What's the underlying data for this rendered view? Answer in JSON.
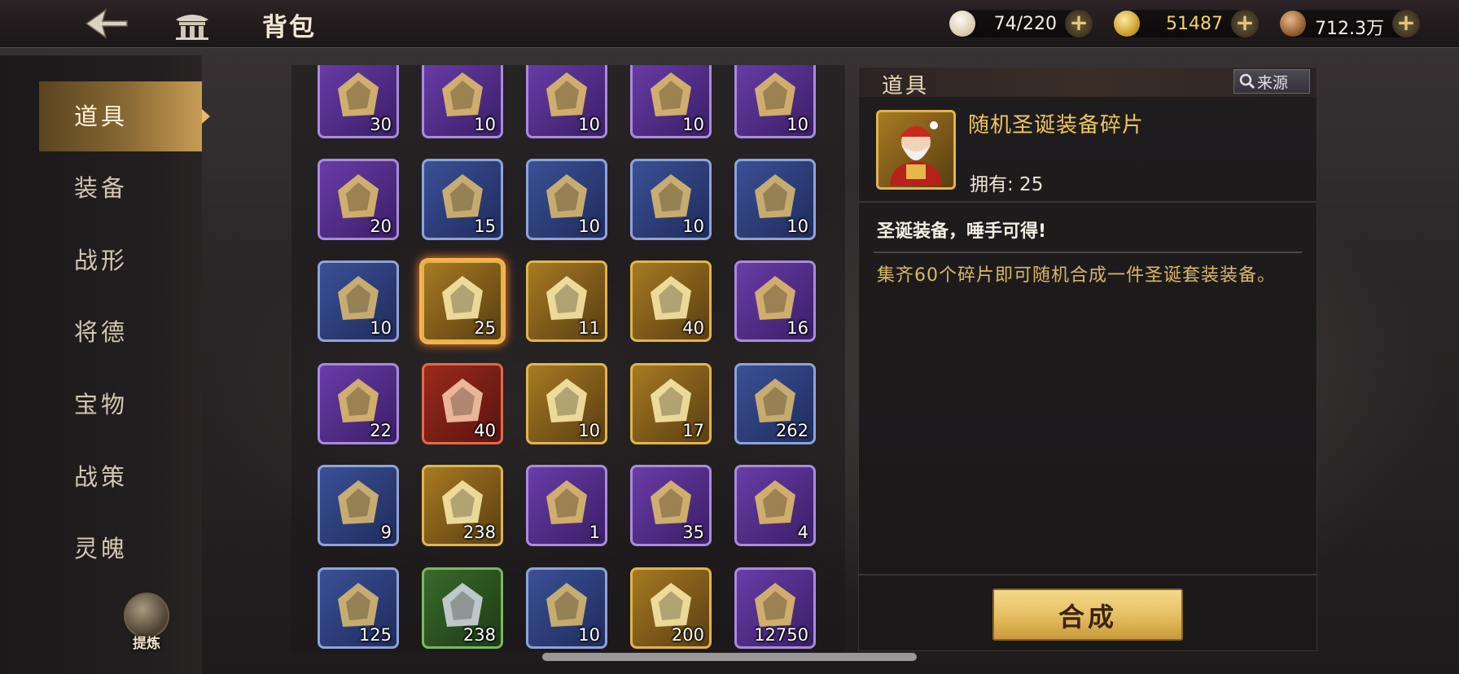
{
  "header": {
    "title": "背包",
    "resources": [
      {
        "icon": "bun-icon",
        "value": "74/220",
        "color": "#f4efe6"
      },
      {
        "icon": "gold-ingot-icon",
        "value": "51487",
        "color": "#f2d36a"
      },
      {
        "icon": "copper-coin-icon",
        "value": "712.3万",
        "color": "#f4efe6"
      }
    ]
  },
  "sidebar": {
    "items": [
      {
        "label": "道具",
        "active": true
      },
      {
        "label": "装备"
      },
      {
        "label": "战形"
      },
      {
        "label": "将德"
      },
      {
        "label": "宝物"
      },
      {
        "label": "战策"
      },
      {
        "label": "灵魄"
      }
    ],
    "refine_label": "提炼"
  },
  "inventory": {
    "rows": [
      [
        {
          "q": "purple",
          "icon": "gold-ornament-fragment-icon",
          "count": "30"
        },
        {
          "q": "purple",
          "icon": "jade-bird-fragment-icon",
          "count": "10"
        },
        {
          "q": "purple",
          "icon": "golden-staff-fragment-icon",
          "count": "10"
        },
        {
          "q": "purple",
          "icon": "scroll-book-fragment-icon",
          "count": "10"
        },
        {
          "q": "purple",
          "icon": "gold-armor-fragment-icon",
          "count": "10"
        }
      ],
      [
        {
          "q": "purple",
          "icon": "golden-beast-fragment-icon",
          "count": "20"
        },
        {
          "q": "blue",
          "icon": "gold-armor-piece-icon",
          "count": "15"
        },
        {
          "q": "blue",
          "icon": "golden-phoenix-fragment-icon",
          "count": "10"
        },
        {
          "q": "blue",
          "icon": "bronze-ring-fragment-icon",
          "count": "10"
        },
        {
          "q": "blue",
          "icon": "jade-tube-fragment-icon",
          "count": "10"
        }
      ],
      [
        {
          "q": "blue",
          "icon": "bamboo-scroll-fragment-icon",
          "count": "10"
        },
        {
          "q": "gold",
          "icon": "santa-fragment-icon",
          "count": "25",
          "selected": true
        },
        {
          "q": "gold",
          "icon": "golden-fragment-box-icon",
          "count": "11"
        },
        {
          "q": "gold",
          "icon": "treasure-sack-icon",
          "count": "40"
        },
        {
          "q": "purple",
          "icon": "purple-fragment-box-icon",
          "count": "16"
        }
      ],
      [
        {
          "q": "purple",
          "icon": "steamed-buns-icon",
          "count": "22"
        },
        {
          "q": "red",
          "icon": "mystery-red-bag-icon",
          "count": "40"
        },
        {
          "q": "gold",
          "icon": "purple-diamond-icon",
          "count": "10"
        },
        {
          "q": "gold",
          "icon": "jade-dragon-statue-icon",
          "count": "17"
        },
        {
          "q": "blue",
          "icon": "iron-horn-icon",
          "count": "262"
        }
      ],
      [
        {
          "q": "blue",
          "icon": "gold-scroll-icon",
          "count": "9"
        },
        {
          "q": "gold",
          "icon": "golden-token-icon",
          "count": "238"
        },
        {
          "q": "purple",
          "icon": "gold-crystal-icon",
          "count": "1"
        },
        {
          "q": "purple",
          "icon": "gold-sand-pile-icon",
          "count": "35"
        },
        {
          "q": "purple",
          "icon": "blue-crystal-cluster-icon",
          "count": "4"
        }
      ],
      [
        {
          "q": "blue",
          "icon": "blue-ore-icon",
          "count": "125"
        },
        {
          "q": "green",
          "icon": "silver-ore-icon",
          "count": "238"
        },
        {
          "q": "blue",
          "icon": "meditation-figure-icon",
          "count": "10"
        },
        {
          "q": "gold",
          "icon": "blue-vortex-icon",
          "count": "200"
        },
        {
          "q": "purple",
          "icon": "red-crystal-icon",
          "count": "12750"
        }
      ]
    ]
  },
  "detail": {
    "tab_label": "道具",
    "source_label": "来源",
    "item_name": "随机圣诞装备碎片",
    "owned_text": "拥有: 25",
    "tagline": "圣诞装备，唾手可得!",
    "description": "集齐60个碎片即可随机合成一件圣诞套装装备。",
    "compose_label": "合成"
  },
  "colors": {
    "accent_gold": "#f0c65a",
    "nav_active": "#c79d55"
  }
}
